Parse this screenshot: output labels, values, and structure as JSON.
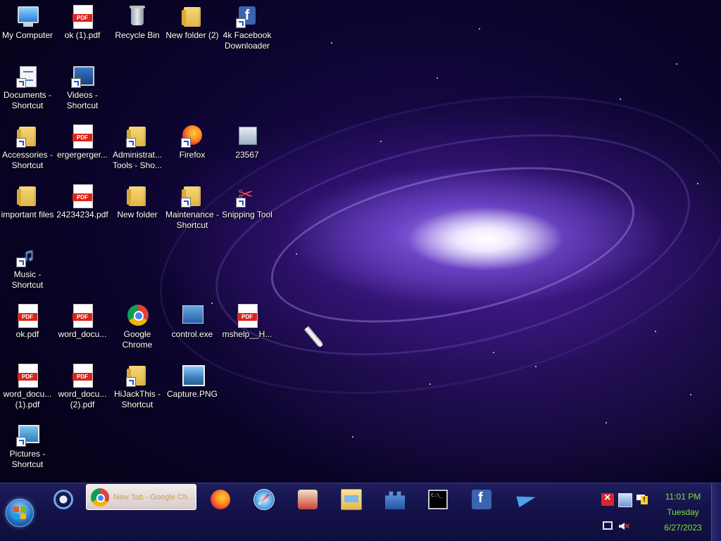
{
  "desktop": {
    "icons": [
      {
        "label": "My Computer",
        "glyph": "computer-icon"
      },
      {
        "label": "ok (1).pdf",
        "glyph": "pdf-icon"
      },
      {
        "label": "Recycle Bin",
        "glyph": "recycle-bin-icon"
      },
      {
        "label": "New folder (2)",
        "glyph": "folder-icon"
      },
      {
        "label": "4k Facebook Downloader",
        "glyph": "facebook-downloader-icon"
      },
      {
        "label": "Documents - Shortcut",
        "glyph": "documents-icon"
      },
      {
        "label": "Videos - Shortcut",
        "glyph": "videos-icon"
      },
      {
        "label": "Accessories - Shortcut",
        "glyph": "accessories-icon"
      },
      {
        "label": "ergergerger...",
        "glyph": "pdf-icon"
      },
      {
        "label": "Administrat... Tools - Sho...",
        "glyph": "folder-icon"
      },
      {
        "label": "Firefox",
        "glyph": "firefox-icon"
      },
      {
        "label": "23567",
        "glyph": "app-icon"
      },
      {
        "label": "important files",
        "glyph": "folder-icon"
      },
      {
        "label": "24234234.pdf",
        "glyph": "pdf-icon"
      },
      {
        "label": "New folder",
        "glyph": "folder-icon"
      },
      {
        "label": "Maintenance - Shortcut",
        "glyph": "folder-icon"
      },
      {
        "label": "Snipping Tool",
        "glyph": "scissors-icon"
      },
      {
        "label": "Music - Shortcut",
        "glyph": "music-icon"
      },
      {
        "label": "ok.pdf",
        "glyph": "pdf-icon"
      },
      {
        "label": "word_docu...",
        "glyph": "pdf-icon"
      },
      {
        "label": "Google Chrome",
        "glyph": "chrome-icon"
      },
      {
        "label": "control.exe",
        "glyph": "control-panel-icon"
      },
      {
        "label": "mshelp__H...",
        "glyph": "pdf-icon"
      },
      {
        "label": "word_docu... (1).pdf",
        "glyph": "pdf-icon"
      },
      {
        "label": "word_docu... (2).pdf",
        "glyph": "pdf-icon"
      },
      {
        "label": "HiJackThis - Shortcut",
        "glyph": "folder-icon"
      },
      {
        "label": "Capture.PNG",
        "glyph": "image-icon"
      },
      {
        "label": "Pictures - Shortcut",
        "glyph": "pictures-icon"
      }
    ]
  },
  "taskbar": {
    "active_window_title": "New Tab - Google Chrome",
    "pinned": [
      {
        "name": "sync-center-icon"
      },
      {
        "name": "firefox-icon"
      },
      {
        "name": "safari-icon"
      },
      {
        "name": "spybot-icon"
      },
      {
        "name": "file-explorer-icon"
      },
      {
        "name": "castle-app-icon"
      },
      {
        "name": "command-prompt-icon"
      },
      {
        "name": "facebook-downloader-icon"
      },
      {
        "name": "telegram-icon"
      }
    ],
    "tray": [
      "error-icon",
      "network-icon",
      "action-center-flag-icon",
      "monitor-icon",
      "volume-muted-icon"
    ],
    "clock": {
      "time": "11:01 PM",
      "day": "Tuesday",
      "date": "6/27/2023"
    }
  }
}
